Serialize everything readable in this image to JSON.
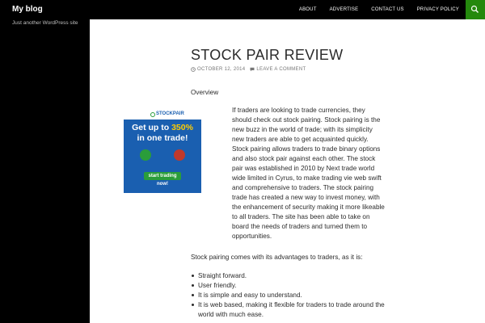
{
  "site": {
    "title": "My blog",
    "tagline": "Just another WordPress site"
  },
  "nav": {
    "items": [
      "ABOUT",
      "ADVERTISE",
      "CONTACT US",
      "PRIVACY POLICY"
    ],
    "search_icon": "search-icon"
  },
  "colors": {
    "accent": "#24890d",
    "background": "#000000",
    "content_bg": "#ffffff"
  },
  "post": {
    "title": "STOCK PAIR REVIEW",
    "date": "OCTOBER 12, 2014",
    "comments": "LEAVE A COMMENT",
    "overview": "Overview",
    "intro": "If traders are looking to trade currencies, they should check out stock pairing. Stock pairing is the new buzz in the world of trade; with its simplicity new traders are able to get acquainted quickly. Stock pairing allows traders to trade binary options and also stock pair against each other. The stock pair was established in 2010 by Next trade world wide limited in Cyrus, to make trading vie web swift and comprehensive to traders. The stock pairing trade has created a new way to invest money, with the enhancement of security making it more likeable to all traders. The site has been able to take on board the needs of traders and turned them to opportunities.",
    "advantages_intro": "Stock pairing comes with its advantages to traders, as it is:",
    "advantages": [
      "Straight forward.",
      "User friendly.",
      "It is simple and easy to understand.",
      "It is web based, making it flexible for traders to trade around the world with much ease."
    ]
  },
  "ad": {
    "brand": "STOCKPAIR",
    "line1": "Get up to ",
    "percent": "350%",
    "line2": "in one trade!",
    "cta": "start trading now!"
  }
}
